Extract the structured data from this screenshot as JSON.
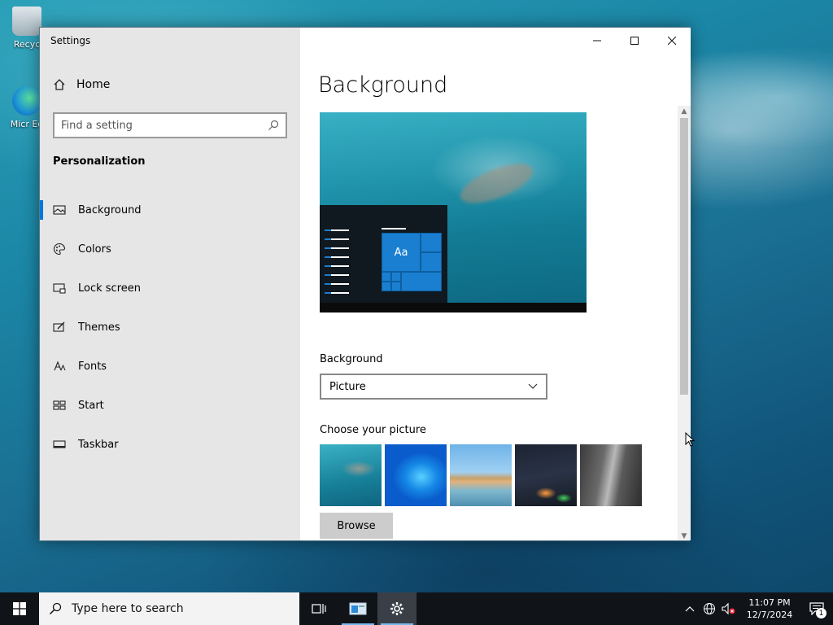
{
  "desktop": {
    "icons": [
      {
        "label": "Recycle Bin",
        "visible_label": "Recyc"
      },
      {
        "label": "Microsoft Edge",
        "visible_label": "Micr Ed"
      }
    ]
  },
  "window": {
    "title": "Settings",
    "controls": {
      "minimize": "—",
      "maximize": "☐",
      "close": "✕"
    }
  },
  "sidebar": {
    "home_label": "Home",
    "search_placeholder": "Find a setting",
    "section": "Personalization",
    "items": [
      {
        "label": "Background",
        "icon": "picture-icon",
        "glyph": "▭"
      },
      {
        "label": "Colors",
        "icon": "palette-icon",
        "glyph": "◎"
      },
      {
        "label": "Lock screen",
        "icon": "lock-screen-icon",
        "glyph": "▭"
      },
      {
        "label": "Themes",
        "icon": "themes-icon",
        "glyph": "✎"
      },
      {
        "label": "Fonts",
        "icon": "fonts-icon",
        "glyph": "A"
      },
      {
        "label": "Start",
        "icon": "start-icon",
        "glyph": "▦"
      },
      {
        "label": "Taskbar",
        "icon": "taskbar-icon",
        "glyph": "▬"
      }
    ],
    "active_index": 0
  },
  "main": {
    "title": "Background",
    "preview_tile_text": "Aa",
    "background_label": "Background",
    "background_value": "Picture",
    "choose_label": "Choose your picture",
    "browse_label": "Browse"
  },
  "taskbar": {
    "search_placeholder": "Type here to search",
    "time": "11:07 PM",
    "date": "12/7/2024",
    "notification_count": "1"
  },
  "colors": {
    "accent": "#0078d7",
    "sidebar_bg": "#e6e6e6",
    "taskbar_bg": "#101419"
  }
}
